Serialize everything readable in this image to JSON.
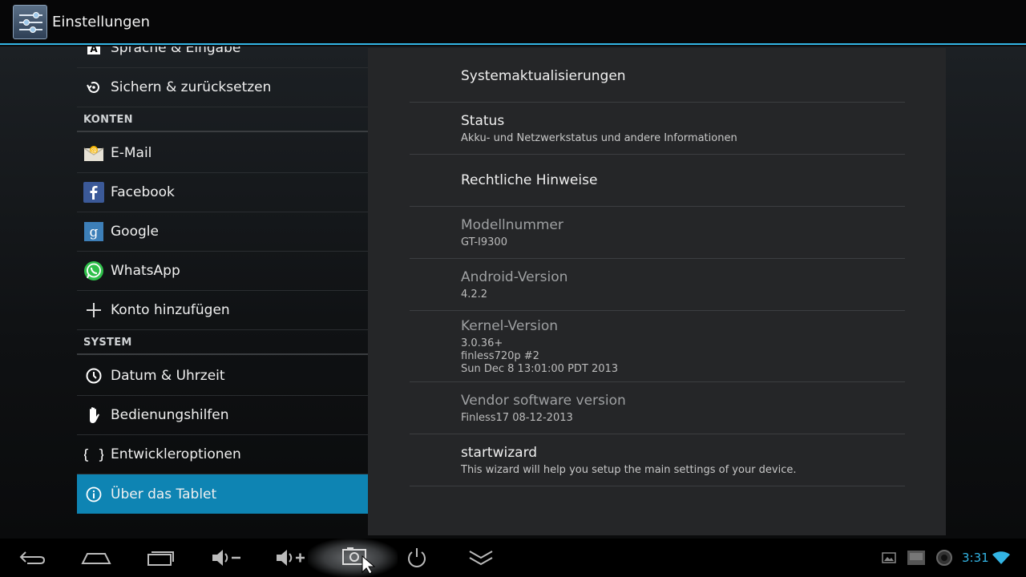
{
  "action_bar": {
    "title": "Einstellungen",
    "icon": "settings-sliders-icon"
  },
  "left_list": {
    "items_top": [
      {
        "label": "Sprache & Eingabe",
        "icon": "keyboard-a-icon"
      },
      {
        "label": "Sichern & zurücksetzen",
        "icon": "backup-restore-icon"
      }
    ],
    "section_accounts": "KONTEN",
    "accounts": [
      {
        "label": "E-Mail",
        "icon": "email-envelope-icon"
      },
      {
        "label": "Facebook",
        "icon": "facebook-icon"
      },
      {
        "label": "Google",
        "icon": "google-icon"
      },
      {
        "label": "WhatsApp",
        "icon": "whatsapp-icon"
      },
      {
        "label": "Konto hinzufügen",
        "icon": "plus-icon"
      }
    ],
    "section_system": "SYSTEM",
    "system": [
      {
        "label": "Datum & Uhrzeit",
        "icon": "clock-icon"
      },
      {
        "label": "Bedienungshilfen",
        "icon": "hand-icon"
      },
      {
        "label": "Entwickleroptionen",
        "icon": "braces-icon"
      },
      {
        "label": "Über das Tablet",
        "icon": "info-icon",
        "selected": true
      }
    ]
  },
  "detail": {
    "system_updates": {
      "title": "Systemaktualisierungen"
    },
    "status": {
      "title": "Status",
      "summary": "Akku- und Netzwerkstatus und andere Informationen"
    },
    "legal": {
      "title": "Rechtliche Hinweise"
    },
    "model": {
      "title": "Modellnummer",
      "summary": "GT-I9300"
    },
    "android_version": {
      "title": "Android-Version",
      "summary": "4.2.2"
    },
    "kernel": {
      "title": "Kernel-Version",
      "line1": "3.0.36+",
      "line2": "finless720p #2",
      "line3": "Sun Dec 8 13:01:00 PDT 2013"
    },
    "vendor": {
      "title": "Vendor software version",
      "summary": "Finless17 08-12-2013"
    },
    "wizard": {
      "title": "startwizard",
      "summary": "This wizard will help you setup the main settings of your device."
    }
  },
  "navbar": {
    "buttons": [
      "back-icon",
      "home-icon",
      "recent-apps-icon",
      "volume-down-icon",
      "volume-up-icon",
      "screenshot-icon",
      "power-icon",
      "collapse-icon"
    ],
    "status_icons": [
      "gallery-notification-icon",
      "sd-card-icon",
      "camera-notification-icon",
      "wifi-icon"
    ],
    "clock": "3:31"
  },
  "colors": {
    "accent": "#33b5e5",
    "selected": "#0e84b3",
    "panel": "#252628"
  }
}
